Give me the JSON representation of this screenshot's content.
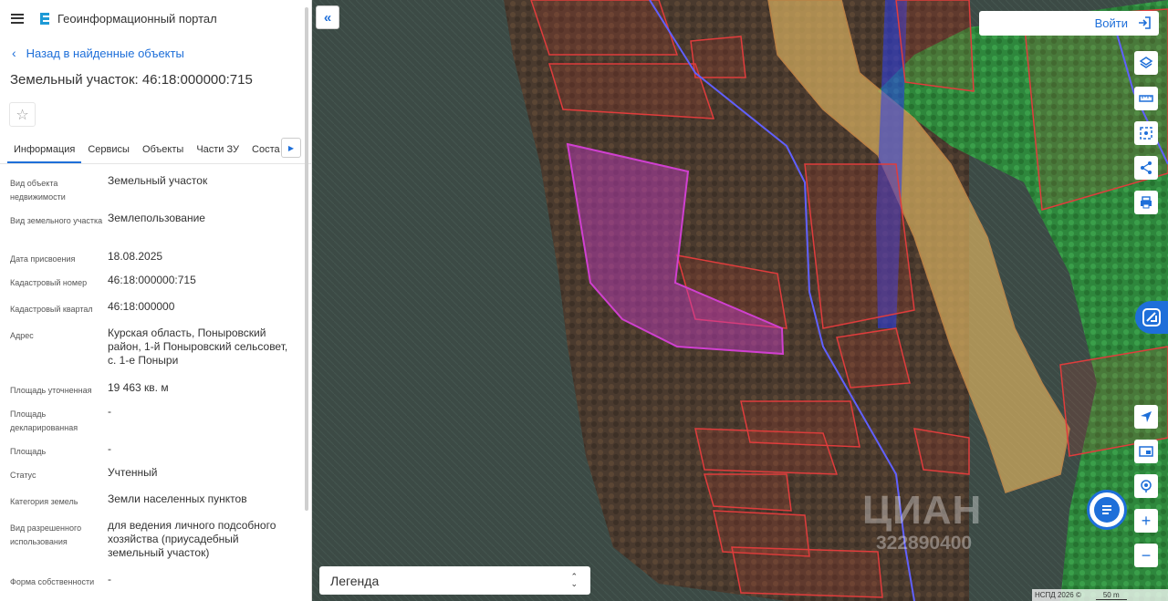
{
  "header": {
    "app_title": "Геоинформационный портал",
    "menu_icon": "hamburger-icon",
    "logo_icon": "portal-logo-icon"
  },
  "back_link": "Назад в найденные объекты",
  "object_title": "Земельный участок: 46:18:000000:715",
  "tabs": [
    {
      "label": "Информация",
      "active": true
    },
    {
      "label": "Сервисы"
    },
    {
      "label": "Объекты"
    },
    {
      "label": "Части ЗУ"
    },
    {
      "label": "Соста"
    }
  ],
  "properties": [
    {
      "label": "Вид объекта недвижимости",
      "value": "Земельный участок"
    },
    {
      "label": "Вид земельного участка",
      "value": "Землепользование"
    },
    {
      "label": "Дата присвоения",
      "value": "18.08.2025"
    },
    {
      "label": "Кадастровый номер",
      "value": "46:18:000000:715"
    },
    {
      "label": "Кадастровый квартал",
      "value": "46:18:000000"
    },
    {
      "label": "Адрес",
      "value": "Курская область, Поныровский район, 1-й Поныровский сельсовет, с. 1-е Поныри"
    },
    {
      "label": "Площадь уточненная",
      "value": "19 463 кв. м"
    },
    {
      "label": "Площадь декларированная",
      "value": "-"
    },
    {
      "label": "Площадь",
      "value": "-"
    },
    {
      "label": "Статус",
      "value": "Учтенный"
    },
    {
      "label": "Категория земель",
      "value": "Земли населенных пунктов"
    },
    {
      "label": "Вид разрешенного использования",
      "value": "для ведения личного подсобного хозяйства (приусадебный земельный участок)"
    },
    {
      "label": "Форма собственности",
      "value": "-"
    }
  ],
  "map": {
    "login_label": "Войти",
    "legend_label": "Легенда",
    "watermark": "ЦИАН",
    "watermark_id": "322890400",
    "attribution": "НСПД 2026 ©",
    "scale": "50 m",
    "tools": [
      "layers-icon",
      "ruler-icon",
      "select-area-icon",
      "share-icon",
      "print-icon",
      "locate-icon",
      "minimap-icon",
      "geo-search-icon",
      "zoom-in-icon",
      "zoom-out-icon"
    ],
    "colors": {
      "parcel_border": "#e03c3c",
      "selected_parcel": "#c040c0",
      "forest_zone": "#22b04a",
      "water_zone": "#2a3ef0",
      "sand_zone": "#e8c070",
      "accent": "#1e6fd9"
    }
  }
}
